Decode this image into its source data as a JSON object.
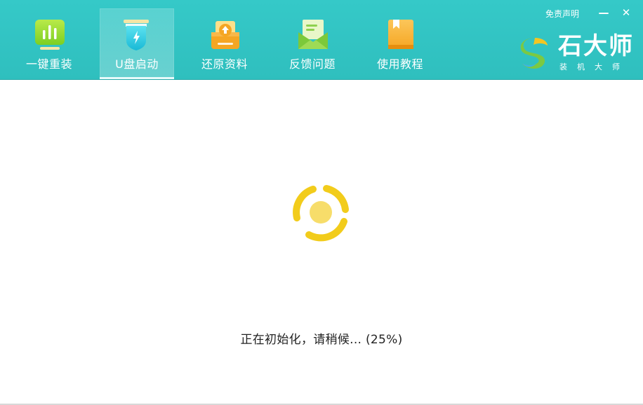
{
  "header": {
    "nav": [
      {
        "label": "一键重装",
        "icon": "bar-chart-icon"
      },
      {
        "label": "U盘启动",
        "icon": "usb-drive-icon"
      },
      {
        "label": "还原资料",
        "icon": "restore-drive-icon"
      },
      {
        "label": "反馈问题",
        "icon": "mail-envelope-icon"
      },
      {
        "label": "使用教程",
        "icon": "book-icon"
      }
    ],
    "active_tab": "U盘启动",
    "disclaimer": "免责声明",
    "minimize": "—",
    "close": "✕",
    "brand": {
      "name": "石大师",
      "subtitle": "装机大师"
    }
  },
  "main": {
    "status_text": "正在初始化，请稍候... (25%)",
    "progress_percent": 25
  },
  "colors": {
    "header": "#33c6c5",
    "spinner": "#f2cc1b",
    "spinner_core": "#f7dd6a"
  }
}
